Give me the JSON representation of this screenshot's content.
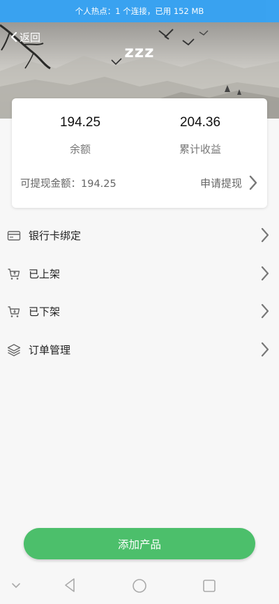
{
  "status_bar": {
    "text": "个人热点：1 个连接，已用 152 MB"
  },
  "header": {
    "back_label": "返回",
    "title": "zzz"
  },
  "account_card": {
    "balance_value": "194.25",
    "balance_label": "余额",
    "earnings_value": "204.36",
    "earnings_label": "累计收益",
    "withdrawable_text": "可提现金额：194.25",
    "withdraw_label": "申请提现"
  },
  "menu": {
    "items": [
      {
        "label": "银行卡绑定",
        "icon": "bank-card-icon"
      },
      {
        "label": "已上架",
        "icon": "cart-up-icon"
      },
      {
        "label": "已下架",
        "icon": "cart-down-icon"
      },
      {
        "label": "订单管理",
        "icon": "layers-icon"
      }
    ]
  },
  "add_product_label": "添加产品",
  "colors": {
    "status_bar": "#2f9ef0",
    "primary_button": "#4cbf6b",
    "background": "#f7f7f7"
  }
}
